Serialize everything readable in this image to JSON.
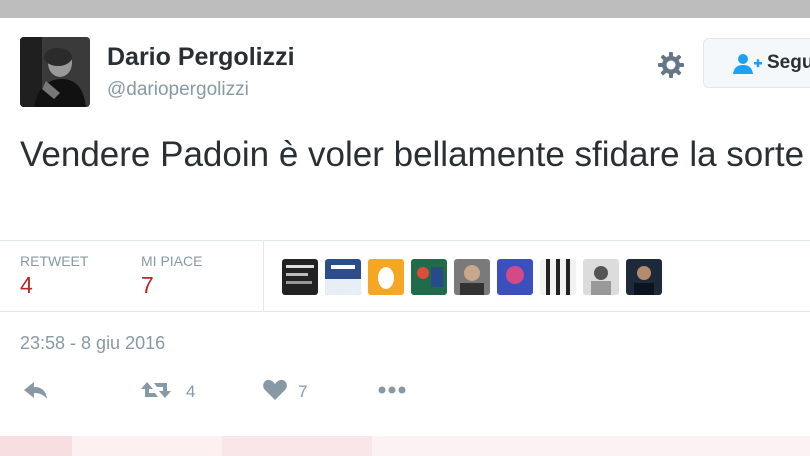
{
  "tweet": {
    "author_name": "Dario Pergolizzi",
    "author_handle": "@dariopergolizzi",
    "text": "Vendere Padoin è voler bellamente sfidare la sorte",
    "timestamp": "23:58 - 8 giu 2016"
  },
  "header": {
    "follow_label": "Segu"
  },
  "stats": {
    "retweet_label": "RETWEET",
    "retweet_count": "4",
    "like_label": "MI PIACE",
    "like_count": "7"
  },
  "actions": {
    "retweet_count": "4",
    "like_count": "7"
  },
  "colors": {
    "accent": "#1da1f2",
    "stat_value": "#b22b2b",
    "muted": "#8899a6",
    "text": "#292f33"
  },
  "icons": [
    "gear-icon",
    "follow-user-icon",
    "reply-icon",
    "retweet-icon",
    "heart-icon",
    "more-icon"
  ]
}
